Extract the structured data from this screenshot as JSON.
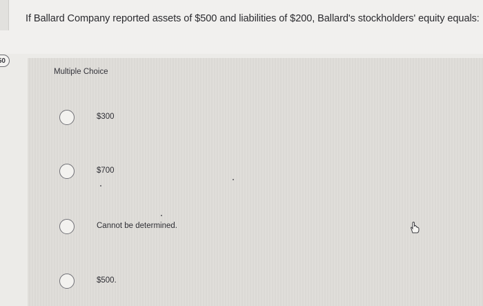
{
  "question": {
    "text": "If Ballard Company reported assets of $500 and liabilities of $200, Ballard's stockholders' equity equals:",
    "number_badge": "50"
  },
  "section_label": "Multiple Choice",
  "options": [
    {
      "label": "$300"
    },
    {
      "label": "$700"
    },
    {
      "label": "Cannot be determined."
    },
    {
      "label": "$500."
    }
  ],
  "cursor_icon": "hand-pointer-icon",
  "colors": {
    "background": "#ecebe8",
    "card": "#dedcd8",
    "text": "#2f2f33"
  }
}
